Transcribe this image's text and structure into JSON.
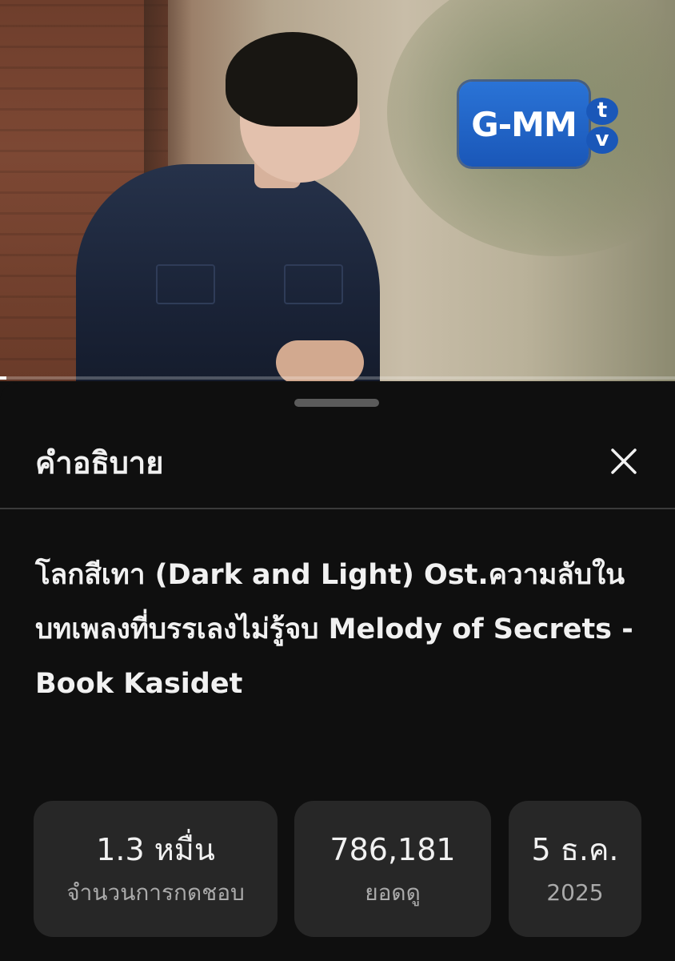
{
  "video": {
    "logo_text": "G-MM",
    "logo_tv_1": "t",
    "logo_tv_2": "v",
    "progress_fraction": 0.01
  },
  "sheet": {
    "title": "คำอธิบาย",
    "close_icon": "close-icon",
    "video_title": "โลกสีเทา (Dark and Light) Ost.ความลับในบทเพลงที่บรรเลงไม่รู้จบ Melody of Secrets - Book Kasidet"
  },
  "stats": {
    "likes_value": "1.3 หมื่น",
    "likes_label": "จำนวนการกดชอบ",
    "views_value": "786,181",
    "views_label": "ยอดดู",
    "date_value": "5 ธ.ค.",
    "date_label": "2025"
  },
  "colors": {
    "background": "#0f0f0f",
    "card": "#272727",
    "text_primary": "#f1f1f1",
    "text_secondary": "#aaaaaa",
    "logo_blue": "#1a57b8"
  }
}
